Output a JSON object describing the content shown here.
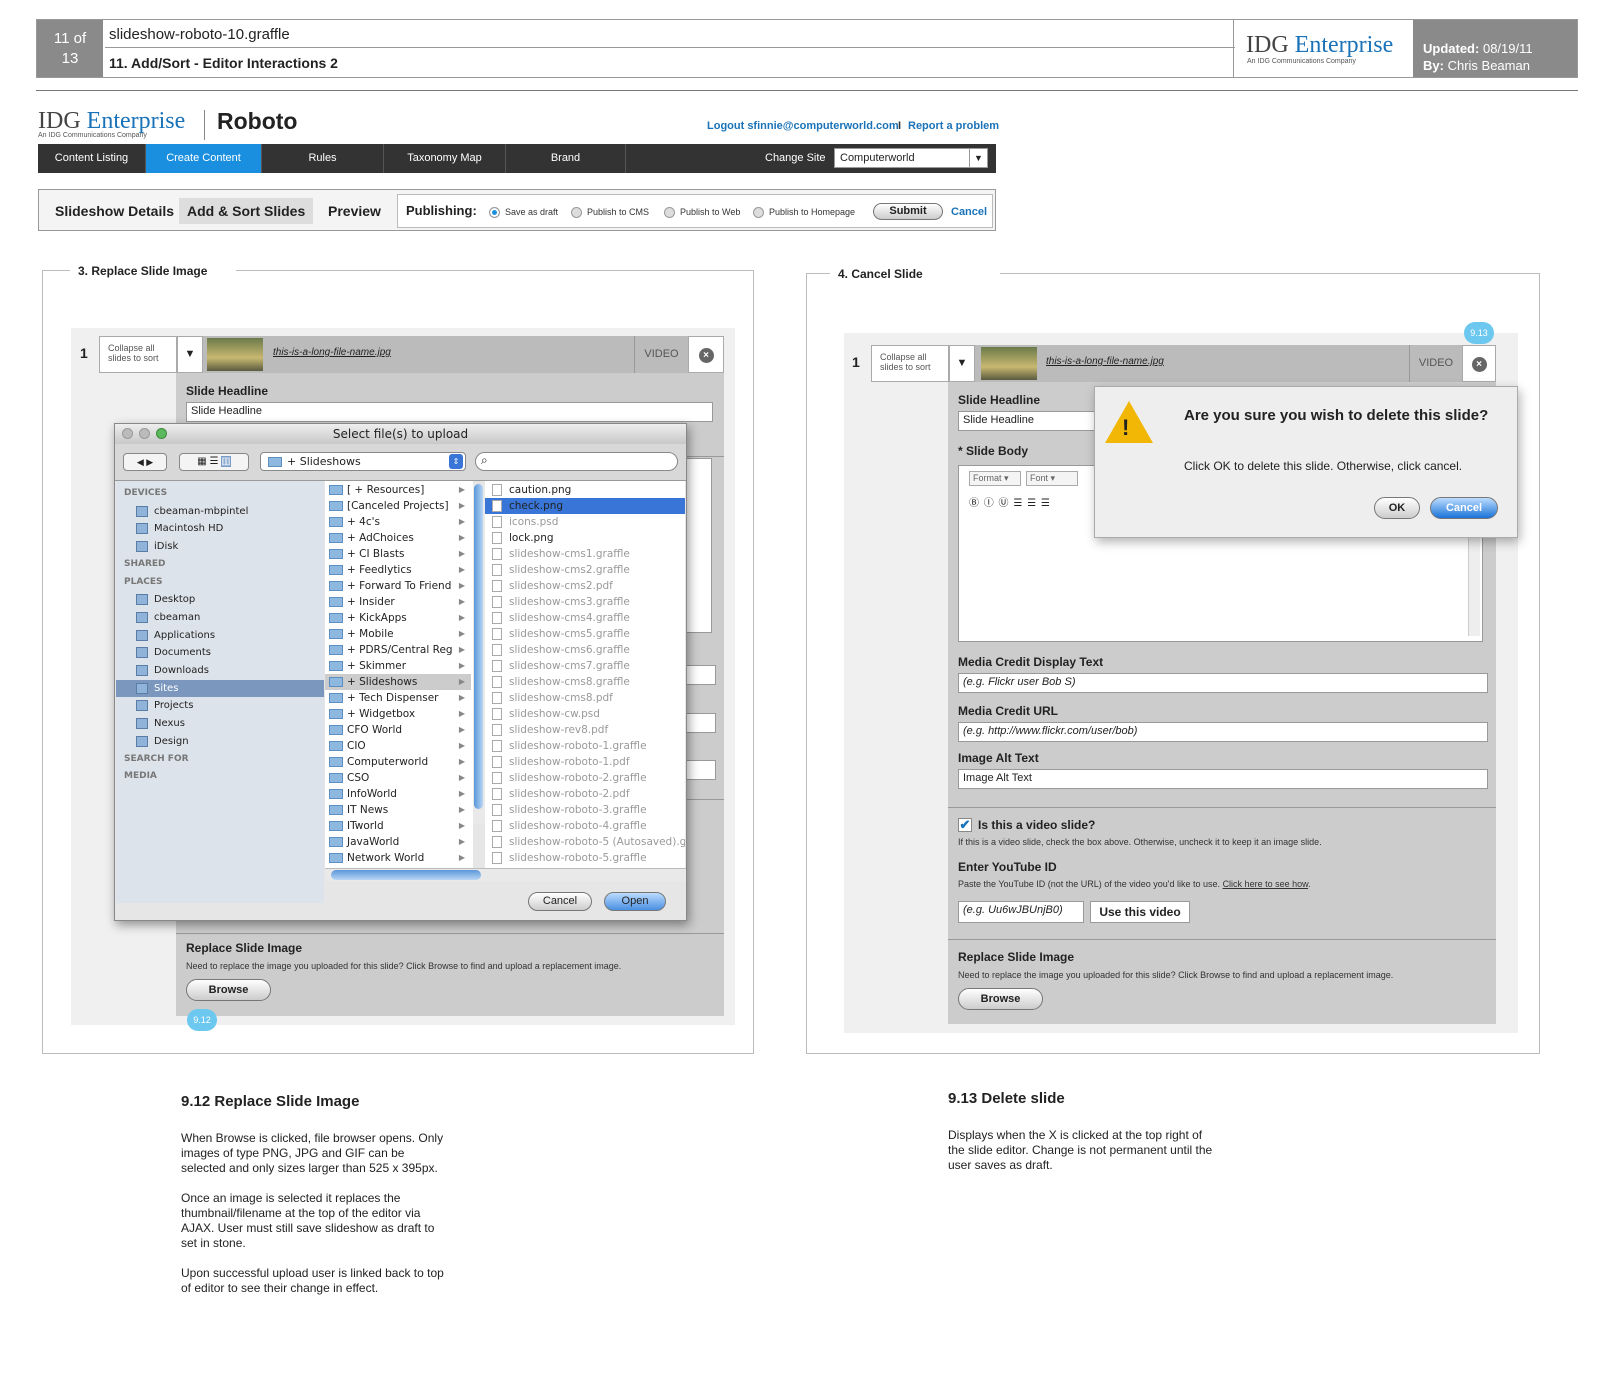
{
  "doc_header": {
    "page_line1": "11 of",
    "page_line2": "13",
    "filename": "slideshow-roboto-10.graffle",
    "section_title": "11. Add/Sort - Editor Interactions 2",
    "logo_word1": "IDG",
    "logo_word2": "Enterprise",
    "logo_sub": "An IDG Communications Company",
    "updated_label": "Updated:",
    "updated_value": "08/19/11",
    "by_label": "By:",
    "by_value": "Chris Beaman"
  },
  "app": {
    "logo_word1": "IDG",
    "logo_word2": "Enterprise",
    "logo_sub": "An IDG Communications Company",
    "app_name": "Roboto",
    "logout_link": "Logout sfinnie@computerworld.com",
    "link_sep": "I",
    "report_link": "Report a problem",
    "nav": [
      "Content Listing",
      "Create Content",
      "Rules",
      "Taxonomy Map",
      "Brand"
    ],
    "change_site_label": "Change Site",
    "site_value": "Computerworld",
    "subnav": [
      "Slideshow Details",
      "Add & Sort Slides",
      "Preview"
    ],
    "publishing_label": "Publishing:",
    "publish_options": [
      "Save as draft",
      "Publish to CMS",
      "Publish to Web",
      "Publish to Homepage"
    ],
    "submit": "Submit",
    "cancel": "Cancel"
  },
  "left_panel": {
    "label": "3. Replace Slide Image",
    "slide_num": "1",
    "collapse": "Collapse all slides to sort",
    "filename": "this-is-a-long-file-name.jpg",
    "type": "VIDEO",
    "headline_label": "Slide Headline",
    "headline_value": "Slide Headline",
    "replace_label": "Replace Slide Image",
    "replace_help": "Need to replace the image you uploaded for this slide? Click Browse to find and upload a replacement image.",
    "browse": "Browse",
    "bubble": "9.12"
  },
  "dialog": {
    "title": "Select file(s) to upload",
    "location": "+ Slideshows",
    "sidebar": [
      {
        "t": "DEVICES",
        "h": true
      },
      {
        "t": "cbeaman-mbpintel"
      },
      {
        "t": "Macintosh HD"
      },
      {
        "t": "iDisk"
      },
      {
        "t": "SHARED",
        "h": true
      },
      {
        "t": "PLACES",
        "h": true
      },
      {
        "t": "Desktop"
      },
      {
        "t": "cbeaman"
      },
      {
        "t": "Applications"
      },
      {
        "t": "Documents"
      },
      {
        "t": "Downloads"
      },
      {
        "t": "Sites",
        "sel": true
      },
      {
        "t": "Projects"
      },
      {
        "t": "Nexus"
      },
      {
        "t": "Design"
      },
      {
        "t": "SEARCH FOR",
        "h": true
      },
      {
        "t": "MEDIA",
        "h": true
      }
    ],
    "folders": [
      "[ + Resources]",
      "[Canceled Projects]",
      "+ 4c's",
      "+ AdChoices",
      "+ CI Blasts",
      "+ Feedlytics",
      "+ Forward To Friend",
      "+ Insider",
      "+ KickApps",
      "+ Mobile",
      "+ PDRS/Central Reg",
      "+ Skimmer",
      "+ Slideshows",
      "+ Tech Dispenser",
      "+ Widgetbox",
      "CFO World",
      "CIO",
      "Computerworld",
      "CSO",
      "InfoWorld",
      "IT News",
      "ITworld",
      "JavaWorld",
      "Network World"
    ],
    "files": [
      {
        "n": "caution.png",
        "e": true
      },
      {
        "n": "check.png",
        "e": true,
        "sel": true
      },
      {
        "n": "icons.psd"
      },
      {
        "n": "lock.png",
        "e": true
      },
      {
        "n": "slideshow-cms1.graffle"
      },
      {
        "n": "slideshow-cms2.graffle"
      },
      {
        "n": "slideshow-cms2.pdf"
      },
      {
        "n": "slideshow-cms3.graffle"
      },
      {
        "n": "slideshow-cms4.graffle"
      },
      {
        "n": "slideshow-cms5.graffle"
      },
      {
        "n": "slideshow-cms6.graffle"
      },
      {
        "n": "slideshow-cms7.graffle"
      },
      {
        "n": "slideshow-cms8.graffle"
      },
      {
        "n": "slideshow-cms8.pdf"
      },
      {
        "n": "slideshow-cw.psd"
      },
      {
        "n": "slideshow-rev8.pdf"
      },
      {
        "n": "slideshow-roboto-1.graffle"
      },
      {
        "n": "slideshow-roboto-1.pdf"
      },
      {
        "n": "slideshow-roboto-2.graffle"
      },
      {
        "n": "slideshow-roboto-2.pdf"
      },
      {
        "n": "slideshow-roboto-3.graffle"
      },
      {
        "n": "slideshow-roboto-4.graffle"
      },
      {
        "n": "slideshow-roboto-5 (Autosaved).g"
      },
      {
        "n": "slideshow-roboto-5.graffle"
      }
    ],
    "cancel": "Cancel",
    "open": "Open"
  },
  "right_panel": {
    "label": "4. Cancel Slide",
    "slide_num": "1",
    "collapse": "Collapse all slides to sort",
    "filename": "this-is-a-long-file-name.jpg",
    "type": "VIDEO",
    "bubble": "9.13",
    "headline_label": "Slide Headline",
    "headline_value": "Slide Headline",
    "body_label": "* Slide Body",
    "format": "Format",
    "font": "Font",
    "credit_label": "Media Credit Display Text",
    "credit_ph": "(e.g. Flickr user Bob S)",
    "url_label": "Media Credit URL",
    "url_ph": "(e.g. http://www.flickr.com/user/bob)",
    "alt_label": "Image Alt Text",
    "alt_value": "Image Alt Text",
    "video_q": "Is this a video slide?",
    "video_help": "If this is a video slide, check the box above. Otherwise, uncheck it to keep it an image slide.",
    "yt_label": "Enter YouTube ID",
    "yt_help": "Paste the YouTube ID (not the URL) of the video you'd like to use.",
    "yt_link": "Click here to see how",
    "yt_ph": "(e.g. Uu6wJBUnjB0)",
    "use_video": "Use this video",
    "replace_label": "Replace Slide Image",
    "replace_help": "Need to replace the image you uploaded for this slide? Click Browse to find and upload a replacement image.",
    "browse": "Browse"
  },
  "confirm": {
    "question": "Are you sure you wish to delete this slide?",
    "detail": "Click OK to delete this slide. Otherwise, click cancel.",
    "ok": "OK",
    "cancel": "Cancel"
  },
  "notes": {
    "left_title": "9.12 Replace Slide Image",
    "left_p1": "When Browse is clicked, file browser opens. Only images of type PNG, JPG and GIF can be selected and only sizes larger than 525 x 395px.",
    "left_p2": "Once an image is selected it replaces the thumbnail/filename at the top of the editor via AJAX. User must still save slideshow as draft to set in stone.",
    "left_p3": "Upon successful upload user is linked back to top of editor to see their change in effect.",
    "right_title": "9.13 Delete slide",
    "right_p1": "Displays when the X is clicked at the top right of the slide editor. Change is not permanent until the user saves as draft."
  }
}
